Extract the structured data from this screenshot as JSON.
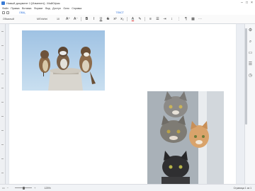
{
  "window": {
    "title": "Новый документ 1 [Изменен] - МойОфис"
  },
  "menu": {
    "items": [
      "Файл",
      "Правка",
      "Вставка",
      "Формат",
      "Вид",
      "Доступ",
      "Окно",
      "Справка"
    ]
  },
  "tabs": {
    "home": "ОБЩ",
    "text": "ТЕКСТ"
  },
  "toolbar": {
    "style_value": "Обычный",
    "font_value": "MSYaHei",
    "size_value": "10",
    "bold": "B",
    "italic": "I",
    "underline": "U",
    "strike": "S",
    "color": "A"
  },
  "status": {
    "zoom": "125%",
    "page_count": "Страница 1 из 1"
  },
  "images": {
    "birds_name": "sparrows-photo",
    "cats_name": "cats-photo"
  },
  "colors": {
    "accent": "#2a6fdb",
    "page_bg": "#ffffff",
    "workspace_bg": "#ebeef3"
  }
}
